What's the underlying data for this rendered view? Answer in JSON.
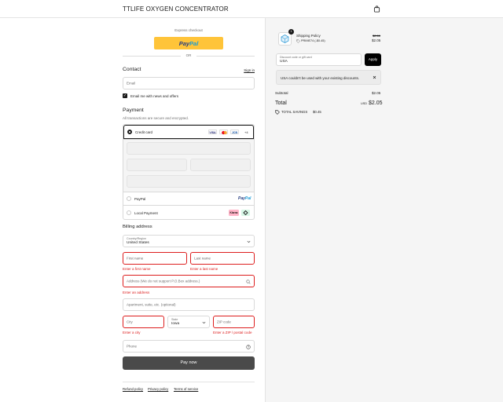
{
  "header": {
    "store_title": "TTLIFE OXYGEN CONCENTRATOR",
    "bag_icon": "shopping-bag-icon"
  },
  "express": {
    "label": "Express checkout",
    "paypal_a": "Pay",
    "paypal_b": "Pal",
    "or": "OR"
  },
  "contact": {
    "heading": "Contact",
    "sign_in": "Sign in",
    "email_placeholder": "Email",
    "news_label": "Email me with news and offers",
    "news_checked": true
  },
  "payment": {
    "heading": "Payment",
    "subtitle": "All transactions are secure and encrypted.",
    "credit_card": "Credit card",
    "card_brands": [
      "VISA",
      "MC",
      "JCB"
    ],
    "more_brands": "+4",
    "paypal": "PayPal",
    "paypal_logo_a": "Pay",
    "paypal_logo_b": "Pal",
    "local_payment": "Local Payment",
    "klarna": "Klarna",
    "selected": "credit_card"
  },
  "billing": {
    "heading": "Billing address",
    "country_label": "Country/Region",
    "country_value": "United States",
    "first_name": "First name",
    "last_name": "Last name",
    "first_name_error": "Enter a first name",
    "last_name_error": "Enter a last name",
    "address": "Address (We do not support P.O.Box address.)",
    "address_error": "Enter an address",
    "apartment": "Apartment, suite, etc. (optional)",
    "city": "City",
    "state_label": "State",
    "state_value": "Iowa",
    "zip": "ZIP code",
    "city_error": "Enter a city",
    "zip_error": "Enter a ZIP / postal code",
    "phone": "Phone"
  },
  "actions": {
    "pay_now": "Pay now"
  },
  "footer": {
    "refund": "Refund policy",
    "privacy": "Privacy policy",
    "terms": "Terms of service"
  },
  "summary": {
    "item_name": "Shipping Policy",
    "item_discount": "PRIME74 (-$0.45)",
    "item_quantity": "1",
    "item_old_price": "$2.50",
    "item_price": "$2.05",
    "discount_label": "Discount code or gift card",
    "discount_value": "USA",
    "apply": "Apply",
    "notice": "USA couldn't be used with your existing discounts.",
    "subtotal_label": "Subtotal",
    "subtotal_value": "$2.05",
    "total_label": "Total",
    "currency": "USD",
    "total_value": "$2.05",
    "savings_label": "TOTAL SAVINGS",
    "savings_value": "$0.45"
  }
}
